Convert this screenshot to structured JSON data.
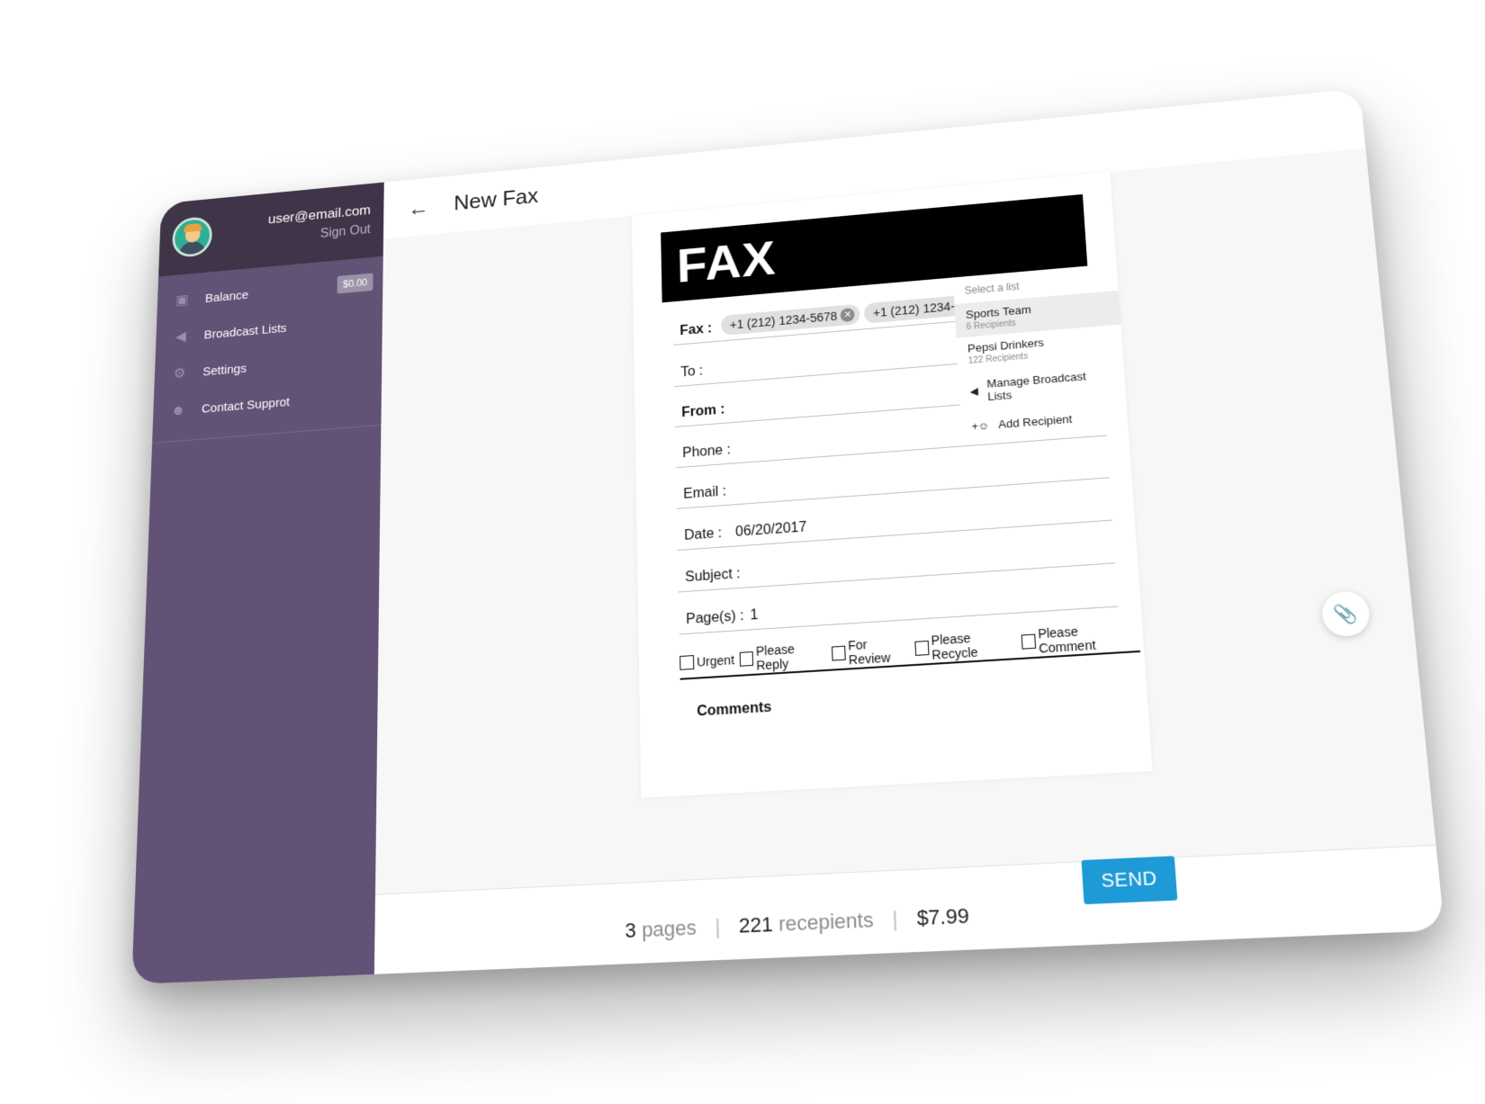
{
  "user": {
    "email": "user@email.com",
    "sign_out": "Sign Out"
  },
  "sidebar": {
    "items": [
      {
        "label": "Balance",
        "icon": "wallet-icon",
        "badge": "$0.00"
      },
      {
        "label": "Broadcast Lists",
        "icon": "megaphone-icon"
      },
      {
        "label": "Settings",
        "icon": "gears-icon"
      },
      {
        "label": "Contact Supprot",
        "icon": "support-agent-icon"
      }
    ]
  },
  "header": {
    "title": "New Fax",
    "back_icon": "arrow-left-icon"
  },
  "fax": {
    "title": "FAX",
    "fax_label": "Fax :",
    "recipients": [
      "+1 (212) 1234-5678",
      "+1 (212) 1234-5678"
    ],
    "to_label": "To :",
    "from_label": "From :",
    "phone_label": "Phone :",
    "email_label": "Email :",
    "date_label": "Date :",
    "date_value": "06/20/2017",
    "subject_label": "Subject :",
    "pages_label": "Page(s) :",
    "pages_value": "1",
    "checkboxes": [
      "Urgent",
      "Please Reply",
      "For Review",
      "Please Recycle",
      "Please Comment"
    ],
    "comments_label": "Comments"
  },
  "dropdown": {
    "header": "Select a list",
    "options": [
      {
        "name": "Sports Team",
        "count": "6 Recipients"
      },
      {
        "name": "Pepsi Drinkers",
        "count": "122 Recipients"
      }
    ],
    "manage_label": "Manage Broadcast Lists",
    "add_label": "Add Recipient"
  },
  "footer": {
    "pages_count": "3",
    "pages_word": "pages",
    "recipients_count": "221",
    "recipients_word": "recepients",
    "price": "$7.99",
    "send_label": "SEND"
  },
  "colors": {
    "sidebar": "#625276",
    "sidebar_header": "#403548",
    "accent": "#1e9ad6"
  }
}
